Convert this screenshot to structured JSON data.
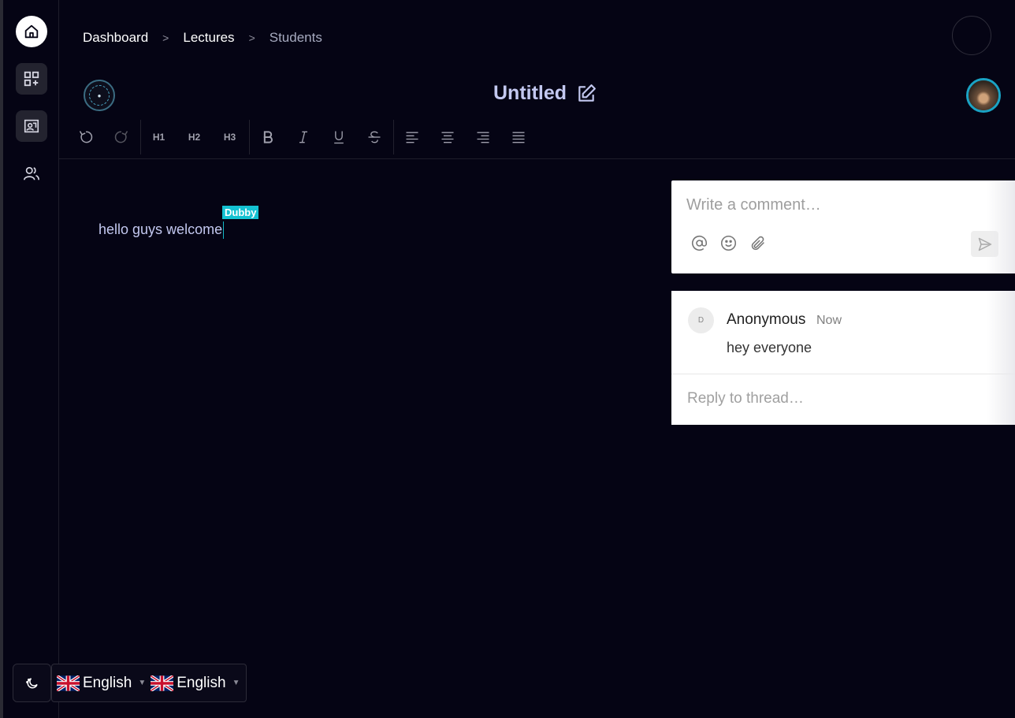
{
  "breadcrumb": {
    "items": [
      "Dashboard",
      "Lectures",
      "Students"
    ],
    "separator": ">"
  },
  "document": {
    "title": "Untitled",
    "content": "hello guys welcome",
    "collaborator_tag": "Dubby"
  },
  "toolbar": {
    "headings": [
      "H1",
      "H2",
      "H3"
    ]
  },
  "comment": {
    "placeholder": "Write a comment…"
  },
  "thread": {
    "avatar_initial": "D",
    "author": "Anonymous",
    "time": "Now",
    "body": "hey everyone",
    "reply_placeholder": "Reply to thread…"
  },
  "language": {
    "first": "English",
    "second": "English"
  },
  "colors": {
    "background": "#050414",
    "title": "#c3c8f0",
    "accent": "#14c2d2"
  },
  "icons": {
    "sidebar": [
      "home-icon",
      "add-grid-icon",
      "classroom-icon",
      "users-icon"
    ],
    "toolbar": [
      "undo-icon",
      "redo-icon",
      "bold-icon",
      "italic-icon",
      "underline-icon",
      "strikethrough-icon",
      "align-left-icon",
      "align-center-icon",
      "align-right-icon",
      "align-justify-icon"
    ],
    "comment": [
      "mention-icon",
      "emoji-icon",
      "attach-icon",
      "send-icon"
    ]
  }
}
